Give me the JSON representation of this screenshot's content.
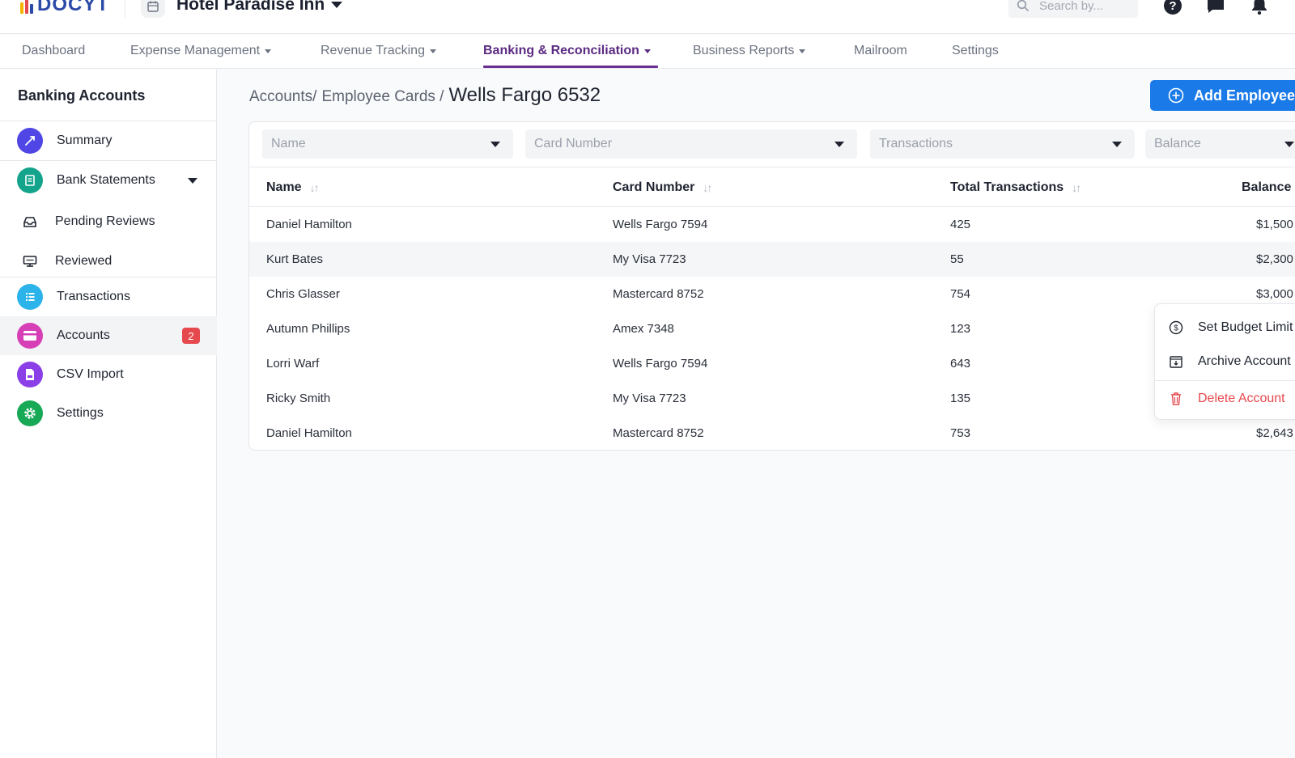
{
  "header": {
    "logo_text": "DOCYT",
    "business_name": "Hotel Paradise Inn",
    "search_placeholder": "Search by...",
    "icons": [
      "help-icon",
      "chat-icon",
      "bell-icon"
    ]
  },
  "nav": {
    "items": [
      {
        "label": "Dashboard"
      },
      {
        "label": "Expense Management"
      },
      {
        "label": "Revenue Tracking"
      },
      {
        "label": "Banking & Reconciliation"
      },
      {
        "label": "Business Reports"
      },
      {
        "label": "Mailroom"
      },
      {
        "label": "Settings"
      }
    ],
    "active": "Banking & Reconciliation"
  },
  "sidebar": {
    "title": "Banking Accounts",
    "items": [
      {
        "label": "Summary",
        "icon": "summary-icon",
        "color": "#4f46e5"
      },
      {
        "label": "Bank Statements",
        "icon": "bank-statements-icon",
        "color": "#14a38b"
      },
      {
        "label": "Pending Reviews",
        "icon": "inbox-icon"
      },
      {
        "label": "Reviewed",
        "icon": "reviewed-icon"
      },
      {
        "label": "Transactions",
        "icon": "list-icon",
        "color": "#2bb3ea"
      },
      {
        "label": "Accounts",
        "icon": "card-icon",
        "color": "#d63fb5",
        "badge": "2"
      },
      {
        "label": "CSV Import",
        "icon": "csv-icon",
        "color": "#8b3fe6"
      },
      {
        "label": "Settings",
        "icon": "gear-icon",
        "color": "#18a957"
      }
    ],
    "active": "Accounts"
  },
  "breadcrumb": {
    "part1": "Accounts/",
    "part2": "Employee Cards /",
    "current": "Wells Fargo 6532"
  },
  "add_button": {
    "label": "Add Employee"
  },
  "filters": {
    "name": "Name",
    "card_number": "Card Number",
    "transactions": "Transactions",
    "balance": "Balance"
  },
  "table": {
    "headers": {
      "name": "Name",
      "card": "Card Number",
      "total": "Total Transactions",
      "balance": "Balance"
    },
    "rows": [
      {
        "name": "Daniel Hamilton",
        "card": "Wells Fargo 7594",
        "total": "425",
        "balance": "$1,500"
      },
      {
        "name": "Kurt Bates",
        "card": "My Visa 7723",
        "total": "55",
        "balance": "$2,300"
      },
      {
        "name": "Chris Glasser",
        "card": "Mastercard 8752",
        "total": "754",
        "balance": "$3,000"
      },
      {
        "name": "Autumn Phillips",
        "card": "Amex 7348",
        "total": "123",
        "balance": ""
      },
      {
        "name": "Lorri Warf",
        "card": "Wells Fargo 7594",
        "total": "643",
        "balance": ""
      },
      {
        "name": "Ricky Smith",
        "card": "My Visa 7723",
        "total": "135",
        "balance": ""
      },
      {
        "name": "Daniel Hamilton",
        "card": "Mastercard 8752",
        "total": "753",
        "balance": "$2,643"
      }
    ]
  },
  "context_menu": {
    "items": [
      {
        "label": "Set Budget Limit",
        "icon": "dollar-circle-icon"
      },
      {
        "label": "Archive Account",
        "icon": "archive-icon"
      },
      {
        "label": "Delete Account",
        "icon": "trash-icon",
        "danger": true
      }
    ]
  },
  "colors": {
    "accent": "#1a7ae8",
    "nav_active": "#5b2a82",
    "danger": "#e5484d"
  }
}
